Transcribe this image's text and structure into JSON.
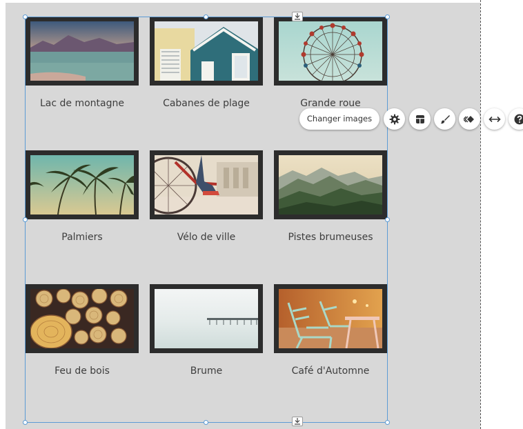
{
  "gallery": {
    "items": [
      {
        "caption": "Lac de montagne"
      },
      {
        "caption": "Cabanes de plage"
      },
      {
        "caption": "Grande roue"
      },
      {
        "caption": "Palmiers"
      },
      {
        "caption": "Vélo de ville"
      },
      {
        "caption": "Pistes brumeuses"
      },
      {
        "caption": "Feu de bois"
      },
      {
        "caption": "Brume"
      },
      {
        "caption": "Café d'Automne"
      }
    ]
  },
  "toolbar": {
    "change_images_label": "Changer images",
    "icons": [
      "gear-icon",
      "layout-icon",
      "paint-brush-icon",
      "animation-icon",
      "stretch-icon",
      "help-icon"
    ]
  },
  "colors": {
    "canvas": "#d8d8d8",
    "selection": "#5b9bd5",
    "frame": "#2c2c2c",
    "caption": "#3d3d3d"
  }
}
